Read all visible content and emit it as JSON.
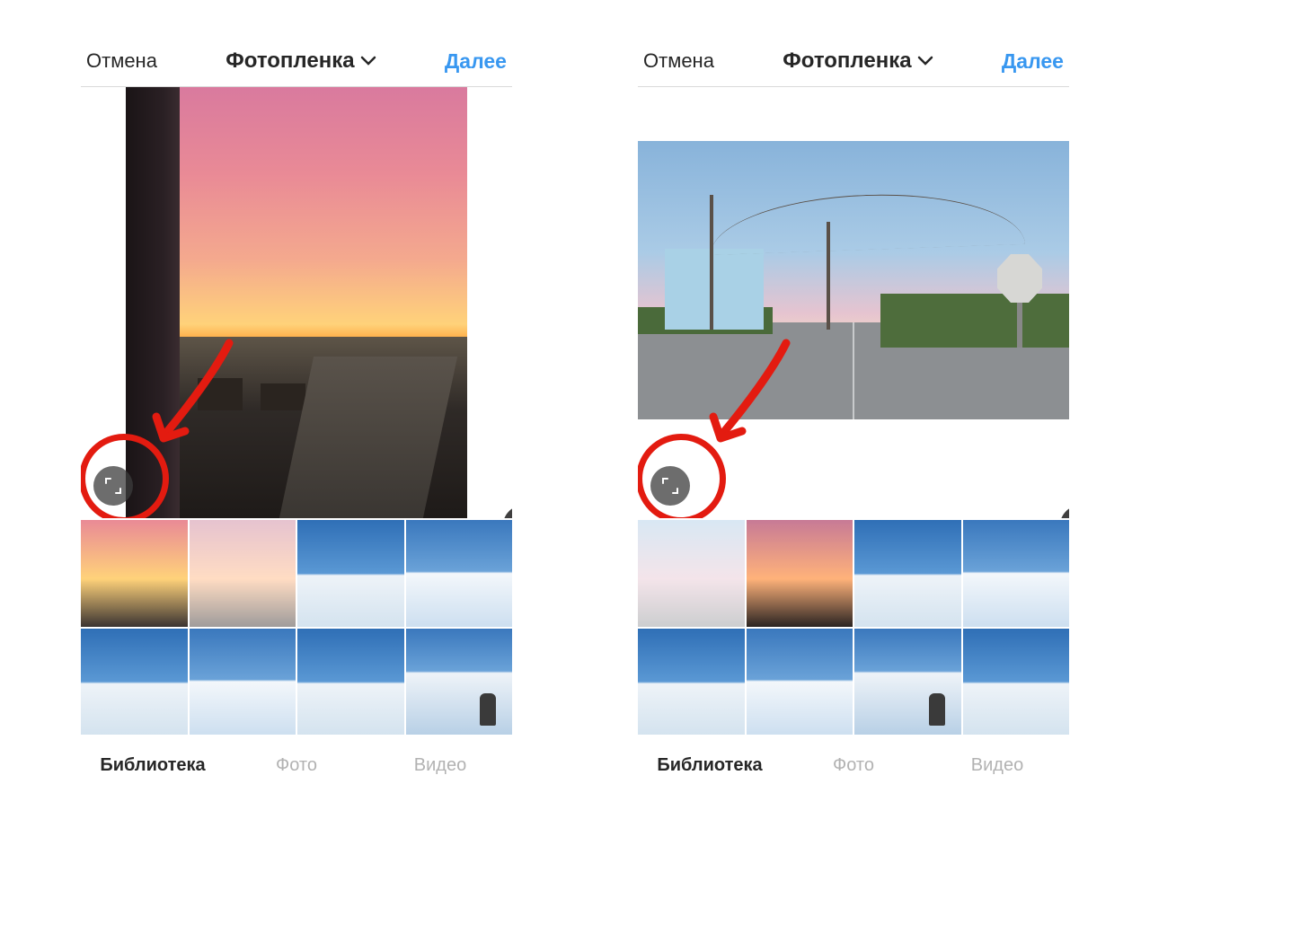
{
  "screens": {
    "left": {
      "nav": {
        "cancel": "Отмена",
        "title": "Фотопленка",
        "next": "Далее"
      },
      "preview": {
        "aspect": "portrait-cropped",
        "description": "sunset-town",
        "buttons": {
          "expand": "expand-icon",
          "boomerang": "infinity-icon",
          "layout": "layout-icon",
          "multi": "multi-select-icon"
        }
      },
      "annotation": {
        "circle_target": "expand-button",
        "arrow": true
      },
      "thumbnails": [
        {
          "kind": "sunset",
          "selected": false
        },
        {
          "kind": "sunset2",
          "selected": true
        },
        {
          "kind": "mountain",
          "selected": false
        },
        {
          "kind": "mountain2",
          "selected": false
        },
        {
          "kind": "mountain",
          "selected": false
        },
        {
          "kind": "mountain2",
          "selected": false
        },
        {
          "kind": "mountain",
          "selected": false
        },
        {
          "kind": "ski",
          "selected": false
        }
      ],
      "tabs": {
        "library": "Библиотека",
        "photo": "Фото",
        "video": "Видео",
        "active": "library"
      }
    },
    "right": {
      "nav": {
        "cancel": "Отмена",
        "title": "Фотопленка",
        "next": "Далее"
      },
      "preview": {
        "aspect": "landscape-fit",
        "description": "beach-road",
        "buttons": {
          "expand": "expand-icon",
          "boomerang": "infinity-icon",
          "layout": "layout-icon",
          "multi": "multi-select-icon"
        }
      },
      "annotation": {
        "circle_target": "expand-button",
        "arrow": true
      },
      "thumbnails": [
        {
          "kind": "beach",
          "selected": true
        },
        {
          "kind": "sunset2",
          "selected": false
        },
        {
          "kind": "mountain",
          "selected": false
        },
        {
          "kind": "mountain2",
          "selected": false
        },
        {
          "kind": "mountain",
          "selected": false
        },
        {
          "kind": "mountain2",
          "selected": false
        },
        {
          "kind": "ski",
          "selected": false
        },
        {
          "kind": "mountain",
          "selected": false
        }
      ],
      "tabs": {
        "library": "Библиотека",
        "photo": "Фото",
        "video": "Видео",
        "active": "library"
      }
    }
  },
  "colors": {
    "accent": "#3897f0",
    "annotation": "#e31b10"
  }
}
